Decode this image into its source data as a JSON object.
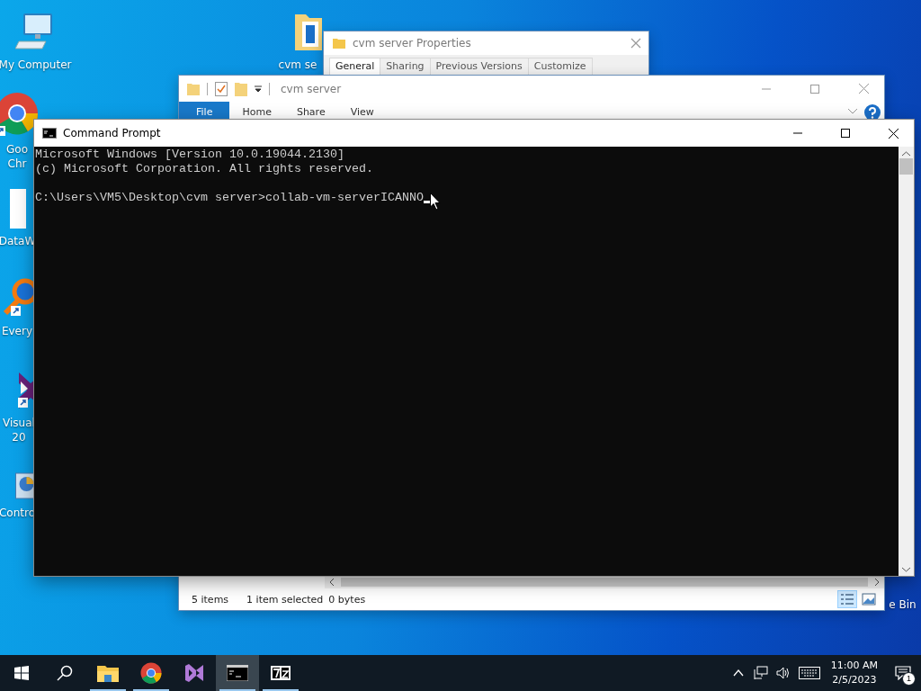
{
  "desktop_icons": [
    {
      "kind": "computer",
      "lines": [
        "My Computer"
      ]
    },
    {
      "kind": "folder",
      "lines": [
        "cvm se"
      ]
    },
    {
      "kind": "chrome",
      "lines": [
        "Goo",
        "Chr"
      ]
    },
    {
      "kind": "document",
      "lines": [
        "DataW"
      ]
    },
    {
      "kind": "search-app",
      "lines": [
        "Every"
      ]
    },
    {
      "kind": "visual-studio",
      "lines": [
        "Visual",
        "20"
      ]
    },
    {
      "kind": "control-panel",
      "lines": [
        "Contro"
      ]
    },
    {
      "kind": "recycle",
      "lines": [
        "e Bin"
      ]
    }
  ],
  "properties_window": {
    "title": "cvm server Properties",
    "tabs": [
      {
        "label": "General",
        "selected": true
      },
      {
        "label": "Sharing",
        "selected": false
      },
      {
        "label": "Previous Versions",
        "selected": false
      },
      {
        "label": "Customize",
        "selected": false
      }
    ]
  },
  "explorer_window": {
    "title": "cvm server",
    "ribbon_tabs": [
      {
        "label": "File",
        "selected": true
      },
      {
        "label": "Home",
        "selected": false
      },
      {
        "label": "Share",
        "selected": false
      },
      {
        "label": "View",
        "selected": false
      }
    ],
    "status_bar": {
      "item_count": "5 items",
      "selection": "1 item selected",
      "size": "0 bytes"
    },
    "view_buttons": [
      {
        "kind": "details",
        "selected": true
      },
      {
        "kind": "large-icons",
        "selected": false
      }
    ]
  },
  "command_window": {
    "title": "Command Prompt",
    "output": [
      "Microsoft Windows [Version 10.0.19044.2130]",
      "(c) Microsoft Corporation. All rights reserved."
    ],
    "prompt": "C:\\Users\\VM5\\Desktop\\cvm server>collab-vm-serverICANNO"
  },
  "taskbar": {
    "items": [
      {
        "kind": "explorer",
        "running": true,
        "selected": false
      },
      {
        "kind": "chrome",
        "running": true,
        "selected": false
      },
      {
        "kind": "visual-studio",
        "running": false,
        "selected": false
      },
      {
        "kind": "terminal",
        "running": true,
        "selected": true
      },
      {
        "kind": "archiver",
        "running": true,
        "selected": false
      }
    ],
    "time": "11:00 AM",
    "date": "2/5/2023",
    "notification_count": "1"
  }
}
